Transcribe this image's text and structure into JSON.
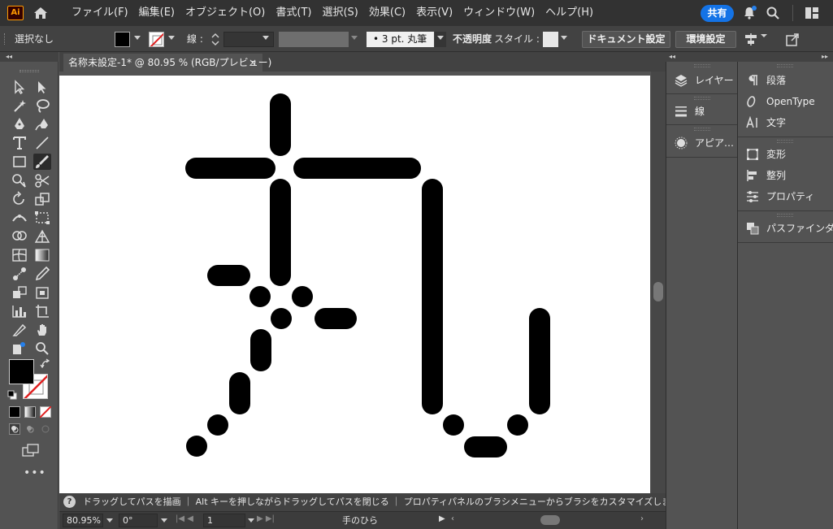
{
  "app": {
    "logo_text": "Ai"
  },
  "menu": [
    "ファイル(F)",
    "編集(E)",
    "オブジェクト(O)",
    "書式(T)",
    "選択(S)",
    "効果(C)",
    "表示(V)",
    "ウィンドウ(W)",
    "ヘルプ(H)"
  ],
  "header": {
    "share_label": "共有"
  },
  "controlbar": {
    "selection": "選択なし",
    "stroke_label": "線 :",
    "brush_value": "•  3 pt. 丸筆",
    "opacity_label": "不透明度",
    "style_label": "スタイル :",
    "document_setup": "ドキュメント設定",
    "preferences": "環境設定"
  },
  "document": {
    "tab_title": "名称未設定-1* @ 80.95 % (RGB/プレビュー)",
    "close": "×"
  },
  "hint": {
    "icon": "?",
    "text": "ドラッグしてパスを描画 ｜ Alt キーを押しながらドラッグしてパスを閉じる ｜ プロパティパネルのブラシメニューからブラシをカスタマイズします"
  },
  "bottombar": {
    "zoom": "80.95%",
    "rotation": "0°",
    "artboard": "1",
    "tool": "手のひら"
  },
  "panels": {
    "col1": [
      {
        "label": "レイヤー",
        "icon": "layers-icon"
      },
      {
        "label": "線",
        "icon": "stroke-icon"
      },
      {
        "label": "アピア…",
        "icon": "appearance-icon"
      }
    ],
    "col2": [
      {
        "label": "段落",
        "icon": "paragraph-icon"
      },
      {
        "label": "OpenType",
        "icon": "opentype-icon"
      },
      {
        "label": "文字",
        "icon": "character-icon"
      },
      {
        "label": "変形",
        "icon": "transform-icon"
      },
      {
        "label": "整列",
        "icon": "align-icon"
      },
      {
        "label": "プロパティ",
        "icon": "properties-icon"
      },
      {
        "label": "パスファインダー",
        "icon": "pathfinder-icon"
      }
    ]
  },
  "colors": {
    "fill": "#000000",
    "stroke_none_slash": "#e02020",
    "accent": "#1473e6",
    "artboard": "#ffffff"
  }
}
